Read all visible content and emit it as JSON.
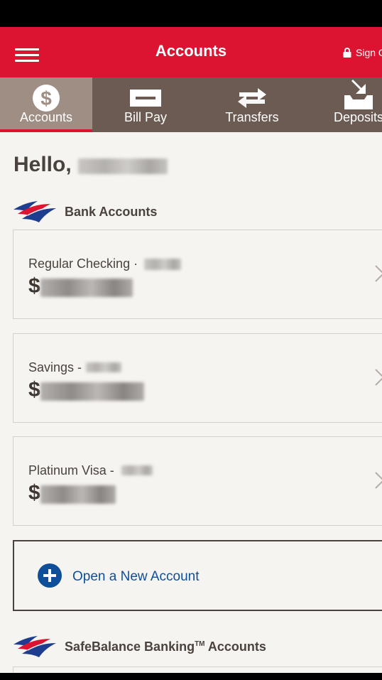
{
  "header": {
    "title": "Accounts",
    "sign_label": "Sign O"
  },
  "tabs": [
    {
      "label": "Accounts",
      "icon": "dollar-icon",
      "active": true
    },
    {
      "label": "Bill Pay",
      "icon": "bill-pay-icon",
      "active": false
    },
    {
      "label": "Transfers",
      "icon": "transfers-icon",
      "active": false
    },
    {
      "label": "Deposits",
      "icon": "deposit-icon",
      "active": false
    }
  ],
  "greeting": {
    "prefix": "Hello,"
  },
  "sections": {
    "bank": {
      "title": "Bank Accounts",
      "icon": "bank-flag-logo"
    },
    "safebalance": {
      "title": "SafeBalance Banking",
      "tm": "TM",
      "suffix": " Accounts"
    }
  },
  "accounts": [
    {
      "name": "Regular Checking ·",
      "currency": "$"
    },
    {
      "name": "Savings -",
      "currency": "$"
    },
    {
      "name": "Platinum Visa -",
      "currency": "$"
    }
  ],
  "open_account": {
    "label": "Open a New Account",
    "icon": "plus-circle-icon"
  },
  "colors": {
    "brand_red": "#dc1431",
    "tab_bg": "#6b5b52",
    "tab_active": "#9e8e83",
    "link_blue": "#0f4e98"
  }
}
